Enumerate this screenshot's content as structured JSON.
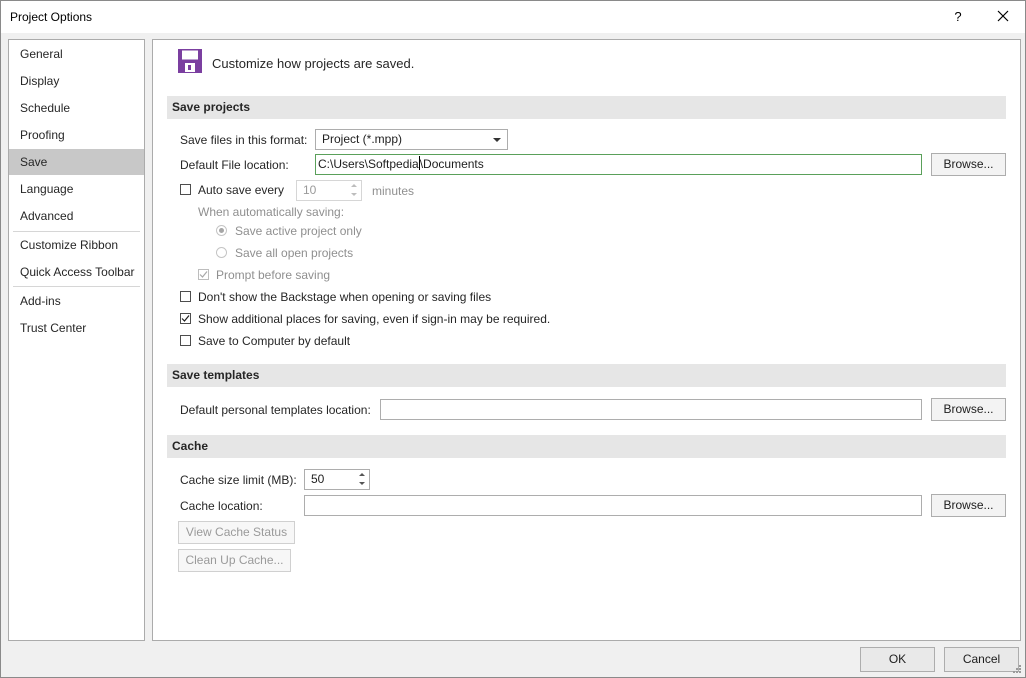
{
  "window": {
    "title": "Project Options",
    "help_glyph": "?",
    "close_icon": "close-icon"
  },
  "sidebar": {
    "items": [
      {
        "label": "General"
      },
      {
        "label": "Display"
      },
      {
        "label": "Schedule"
      },
      {
        "label": "Proofing"
      },
      {
        "label": "Save",
        "selected": true
      },
      {
        "label": "Language"
      },
      {
        "label": "Advanced"
      },
      {
        "label": "Customize Ribbon"
      },
      {
        "label": "Quick Access Toolbar"
      },
      {
        "label": "Add-ins"
      },
      {
        "label": "Trust Center"
      }
    ]
  },
  "header": {
    "icon": "floppy-disk-icon",
    "text": "Customize how projects are saved."
  },
  "save_projects": {
    "title": "Save projects",
    "format_label": "Save files in this format:",
    "format_value": "Project (*.mpp)",
    "location_label": "Default File location:",
    "location_value_before_caret": "C:\\Users\\Softpedia",
    "location_value_after_caret": "\\Documents",
    "browse_label": "Browse...",
    "autosave_label": "Auto save every",
    "autosave_value": "10",
    "autosave_unit": "minutes",
    "when_label": "When automatically saving:",
    "radio_active": "Save active project only",
    "radio_all": "Save all open projects",
    "prompt_label": "Prompt before saving",
    "backstage_label": "Don't show the Backstage when opening or saving files",
    "additional_label": "Show additional places for saving, even if sign-in may be required.",
    "computer_label": "Save to Computer by default"
  },
  "save_templates": {
    "title": "Save templates",
    "location_label": "Default personal templates location:",
    "location_value": "",
    "browse_label": "Browse..."
  },
  "cache": {
    "title": "Cache",
    "size_label": "Cache size limit (MB):",
    "size_value": "50",
    "location_label": "Cache location:",
    "location_value": "",
    "browse_label": "Browse...",
    "view_status_label": "View Cache Status",
    "cleanup_label": "Clean Up Cache..."
  },
  "footer": {
    "ok_label": "OK",
    "cancel_label": "Cancel"
  },
  "colors": {
    "accent_icon": "#7b3fa0",
    "selected_nav": "#c8c8c8",
    "section_bg": "#e6e6e6"
  }
}
